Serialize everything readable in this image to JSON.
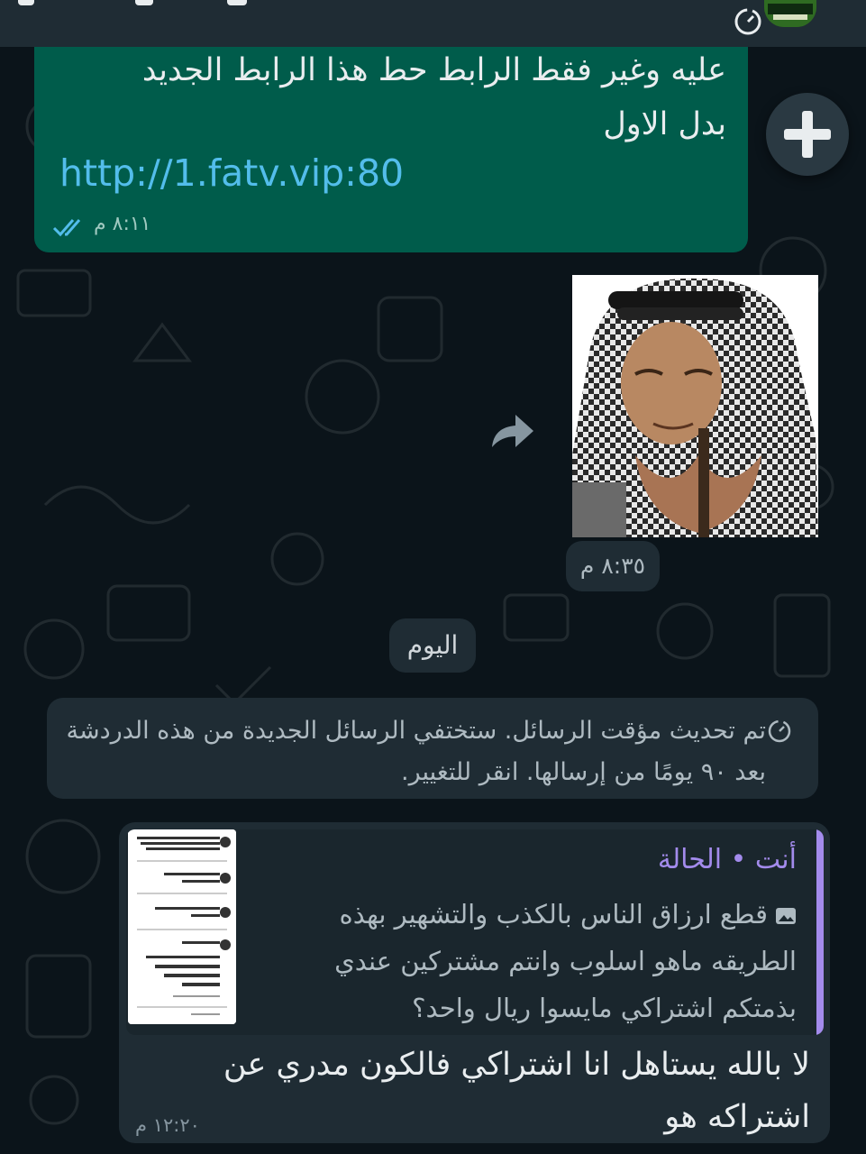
{
  "colors": {
    "background": "#0b141a",
    "outgoing_bubble": "#005c4b",
    "incoming_bubble": "#1f2c34",
    "link": "#53bdeb",
    "read_ticks": "#53bdeb",
    "quote_accent": "#a38bec"
  },
  "header": {
    "timer_icon": "disappearing-timer-icon",
    "avatar": "contact-avatar"
  },
  "outgoing_message": {
    "line1": "عليه وغير فقط الرابط حط هذا الرابط الجديد",
    "line2": "بدل الاول",
    "link": "http://1.fatv.vip:80",
    "time": "٨:١١ م",
    "status_icon": "double-check-read-icon"
  },
  "attach_button": {
    "icon": "plus-icon"
  },
  "sticker_message": {
    "sticker": "elderly-man-heart-hands-sticker",
    "forward_icon": "forward-arrow-icon",
    "time": "٨:٣٥ م"
  },
  "date_divider": "اليوم",
  "system_notice": {
    "icon": "timer-icon",
    "text": "تم تحديث مؤقت الرسائل. ستختفي الرسائل الجديدة من هذه الدردشة بعد ٩٠ يومًا من إرسالها. انقر للتغيير."
  },
  "incoming_message": {
    "quote": {
      "sender": "أنت • الحالة",
      "image_icon": "photo-icon",
      "text": "قطع ارزاق الناس بالكذب والتشهير بهذه الطريقه ماهو اسلوب وانتم مشتركين عندي بذمتكم اشتراكي مايسوا ريال واحد؟",
      "thumbnail": "tweet-screenshot-thumbnail"
    },
    "text": "لا بالله يستاهل انا اشتراكي فالكون مدري عن اشتراكه هو",
    "time": "١٢:٢٠ م"
  }
}
